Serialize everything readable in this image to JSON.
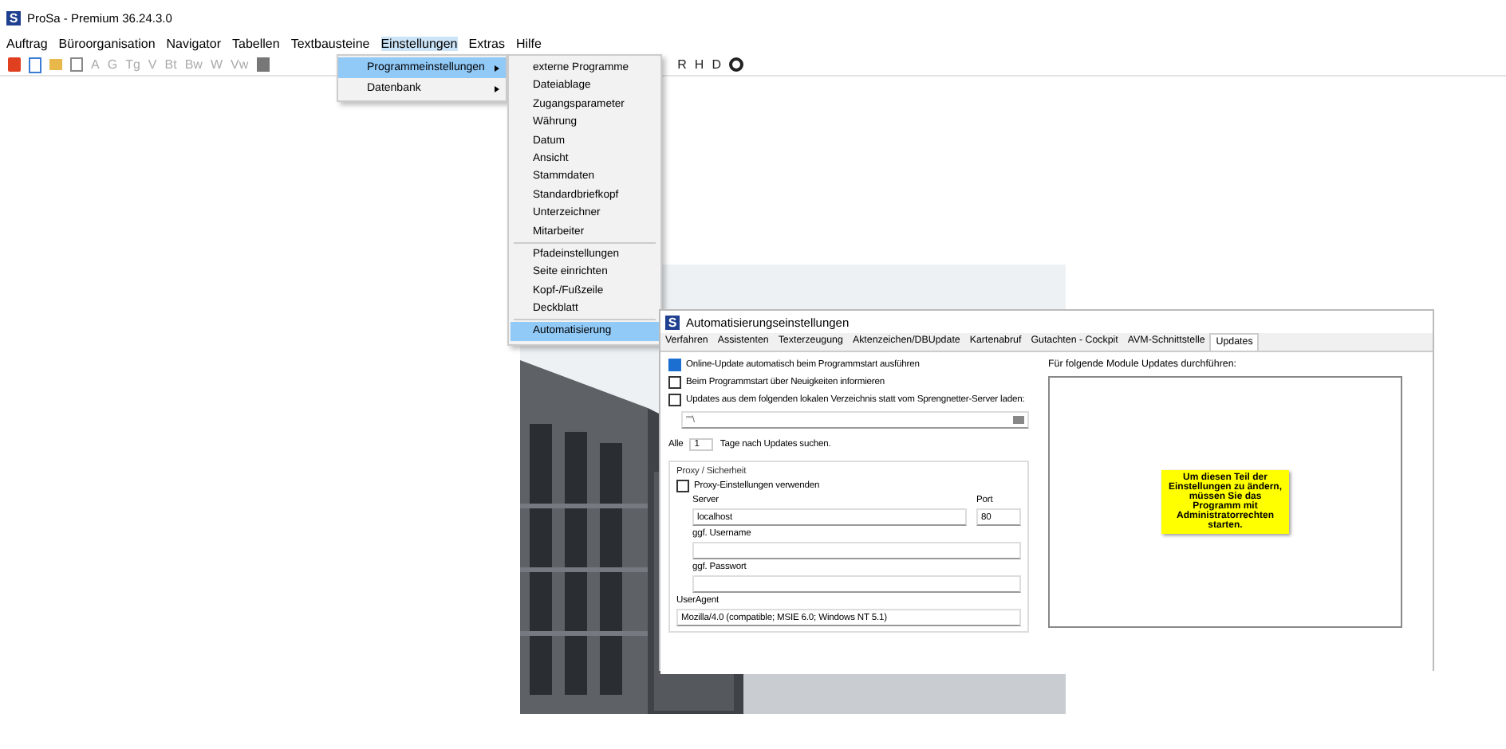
{
  "window": {
    "logo": "S",
    "title": "ProSa - Premium 36.24.3.0"
  },
  "menubar": [
    {
      "label": "Auftrag",
      "selected": false
    },
    {
      "label": "Büroorganisation",
      "selected": false
    },
    {
      "label": "Navigator",
      "selected": false
    },
    {
      "label": "Tabellen",
      "selected": false
    },
    {
      "label": "Textbausteine",
      "selected": false
    },
    {
      "label": "Einstellungen",
      "selected": true
    },
    {
      "label": "Extras",
      "selected": false
    },
    {
      "label": "Hilfe",
      "selected": false
    }
  ],
  "toolbar": {
    "left_letters": [
      "A",
      "G",
      "Tg",
      "V",
      "Bt",
      "Bw",
      "W",
      "Vw"
    ],
    "right_letters": [
      "R",
      "H",
      "D"
    ]
  },
  "menu": {
    "items": [
      {
        "label": "Programmeinstellungen",
        "selected": true
      },
      {
        "label": "Datenbank",
        "selected": false
      }
    ]
  },
  "submenu": {
    "groups": [
      [
        {
          "label": "externe Programme",
          "selected": false
        },
        {
          "label": "Dateiablage",
          "selected": false
        },
        {
          "label": "Zugangsparameter",
          "selected": false
        },
        {
          "label": "Währung",
          "selected": false
        },
        {
          "label": "Datum",
          "selected": false
        },
        {
          "label": "Ansicht",
          "selected": false
        },
        {
          "label": "Stammdaten",
          "selected": false
        },
        {
          "label": "Standardbriefkopf",
          "selected": false
        },
        {
          "label": "Unterzeichner",
          "selected": false
        },
        {
          "label": "Mitarbeiter",
          "selected": false
        }
      ],
      [
        {
          "label": "Pfadeinstellungen",
          "selected": false
        },
        {
          "label": "Seite einrichten",
          "selected": false
        },
        {
          "label": "Kopf-/Fußzeile",
          "selected": false
        },
        {
          "label": "Deckblatt",
          "selected": false
        }
      ],
      [
        {
          "label": "Automatisierung",
          "selected": true
        }
      ]
    ]
  },
  "dialog": {
    "logo": "S",
    "title": "Automatisierungseinstellungen",
    "tabs": [
      {
        "label": "Verfahren",
        "selected": false
      },
      {
        "label": "Assistenten",
        "selected": false
      },
      {
        "label": "Texterzeugung",
        "selected": false
      },
      {
        "label": "Aktenzeichen/DBUpdate",
        "selected": false
      },
      {
        "label": "Kartenabruf",
        "selected": false
      },
      {
        "label": "Gutachten - Cockpit",
        "selected": false
      },
      {
        "label": "AVM-Schnittstelle",
        "selected": false
      },
      {
        "label": "Updates",
        "selected": true
      }
    ],
    "checkboxes": [
      {
        "label": "Online-Update automatisch beim Programmstart ausführen",
        "checked": true
      },
      {
        "label": "Beim Programmstart über Neuigkeiten informieren",
        "checked": false
      },
      {
        "label": "Updates aus dem folgenden lokalen Verzeichnis statt vom Sprengnetter-Server laden:",
        "checked": false
      }
    ],
    "path_field": {
      "value": "\"\"\\"
    },
    "interval": {
      "prefix": "Alle",
      "value": "1",
      "suffix": "Tage nach Updates suchen."
    },
    "proxy": {
      "legend": "Proxy / Sicherheit",
      "use_proxy": {
        "label": "Proxy-Einstellungen verwenden",
        "checked": false
      },
      "server_label": "Server",
      "port_label": "Port",
      "server": "localhost",
      "port": "80",
      "username_label": "ggf. Username",
      "password_label": "ggf. Passwort",
      "useragent_label": "UserAgent",
      "useragent": "Mozilla/4.0 (compatible; MSIE 6.0; Windows NT 5.1)"
    },
    "modules_label": "Für folgende Module Updates durchführen:",
    "admin_note": "Um diesen Teil der Einstellungen zu ändern, müssen Sie das Programm mit Administratorrechten starten."
  }
}
